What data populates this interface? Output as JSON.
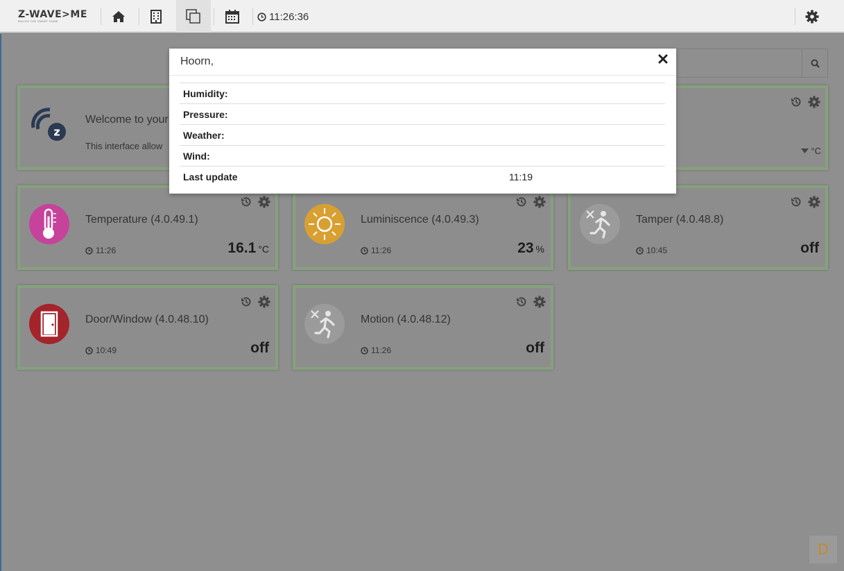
{
  "navbar": {
    "logo_text": "Z-WAVE>ME",
    "logo_tagline": "BUILDS THE SMART HOME",
    "clock": "11:26:36",
    "icons": [
      "home-icon",
      "building-icon",
      "copy-icon",
      "calendar-icon",
      "clock-icon",
      "gear-icon"
    ]
  },
  "search": {
    "placeholder": "",
    "icon": "search-icon"
  },
  "welcome": {
    "title": "Welcome to your",
    "text": "This interface allow",
    "right_unit": "°C"
  },
  "widgets": [
    {
      "title": "Temperature (4.0.49.1)",
      "time": "11:26",
      "level": "16.1",
      "unit": "°C",
      "icon": "thermometer-icon",
      "icon_color": "#c7429a"
    },
    {
      "title": "Luminiscence (4.0.49.3)",
      "time": "11:26",
      "level": "23",
      "unit": "%",
      "icon": "sun-icon",
      "icon_color": "#d89f31"
    },
    {
      "title": "Tamper (4.0.48.8)",
      "time": "10:45",
      "level": "off",
      "unit": "",
      "icon": "motion-off-icon",
      "icon_color": "#9b9b9b"
    },
    {
      "title": "Door/Window (4.0.48.10)",
      "time": "10:49",
      "level": "off",
      "unit": "",
      "icon": "door-icon",
      "icon_color": "#a3242b"
    },
    {
      "title": "Motion (4.0.48.12)",
      "time": "11:26",
      "level": "off",
      "unit": "",
      "icon": "motion-off-icon",
      "icon_color": "#9b9b9b"
    }
  ],
  "modal": {
    "title": "Hoorn,",
    "rows": [
      {
        "label": "Humidity:",
        "value": ""
      },
      {
        "label": "Pressure:",
        "value": ""
      },
      {
        "label": "Weather:",
        "value": ""
      },
      {
        "label": "Wind:",
        "value": ""
      },
      {
        "label": "Last update",
        "value": "11:19"
      }
    ]
  },
  "debug": {
    "label": "D"
  },
  "colors": {
    "accent_border": "#86a17d",
    "overlay_bg": "#8f8f8f",
    "debug_orange": "#c8862c"
  }
}
